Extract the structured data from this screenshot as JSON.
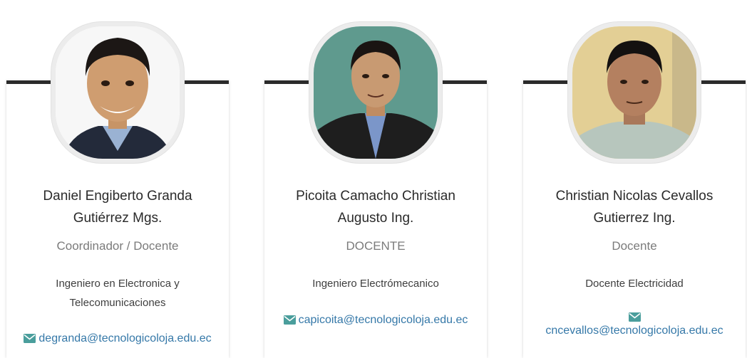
{
  "team": [
    {
      "name": "Daniel Engiberto Granda Gutiérrez Mgs.",
      "role": "Coordinador / Docente",
      "description": "Ingeniero en Electronica y Telecomunicaciones",
      "email": "degranda@tecnologicoloja.edu.ec"
    },
    {
      "name": "Picoita Camacho Christian Augusto Ing.",
      "role": "DOCENTE",
      "description": "Ingeniero Electrómecanico",
      "email": "capicoita@tecnologicoloja.edu.ec"
    },
    {
      "name": "Christian Nicolas Cevallos Gutierrez Ing.",
      "role": "Docente",
      "description": "Docente Electricidad",
      "email": "cncevallos@tecnologicoloja.edu.ec"
    }
  ],
  "icons": {
    "email": "envelope-icon"
  },
  "colors": {
    "card_top_border": "#2b2b2b",
    "email_link": "#3578a8",
    "email_icon": "#4a9e9c",
    "role_text": "#7b7b7b"
  }
}
